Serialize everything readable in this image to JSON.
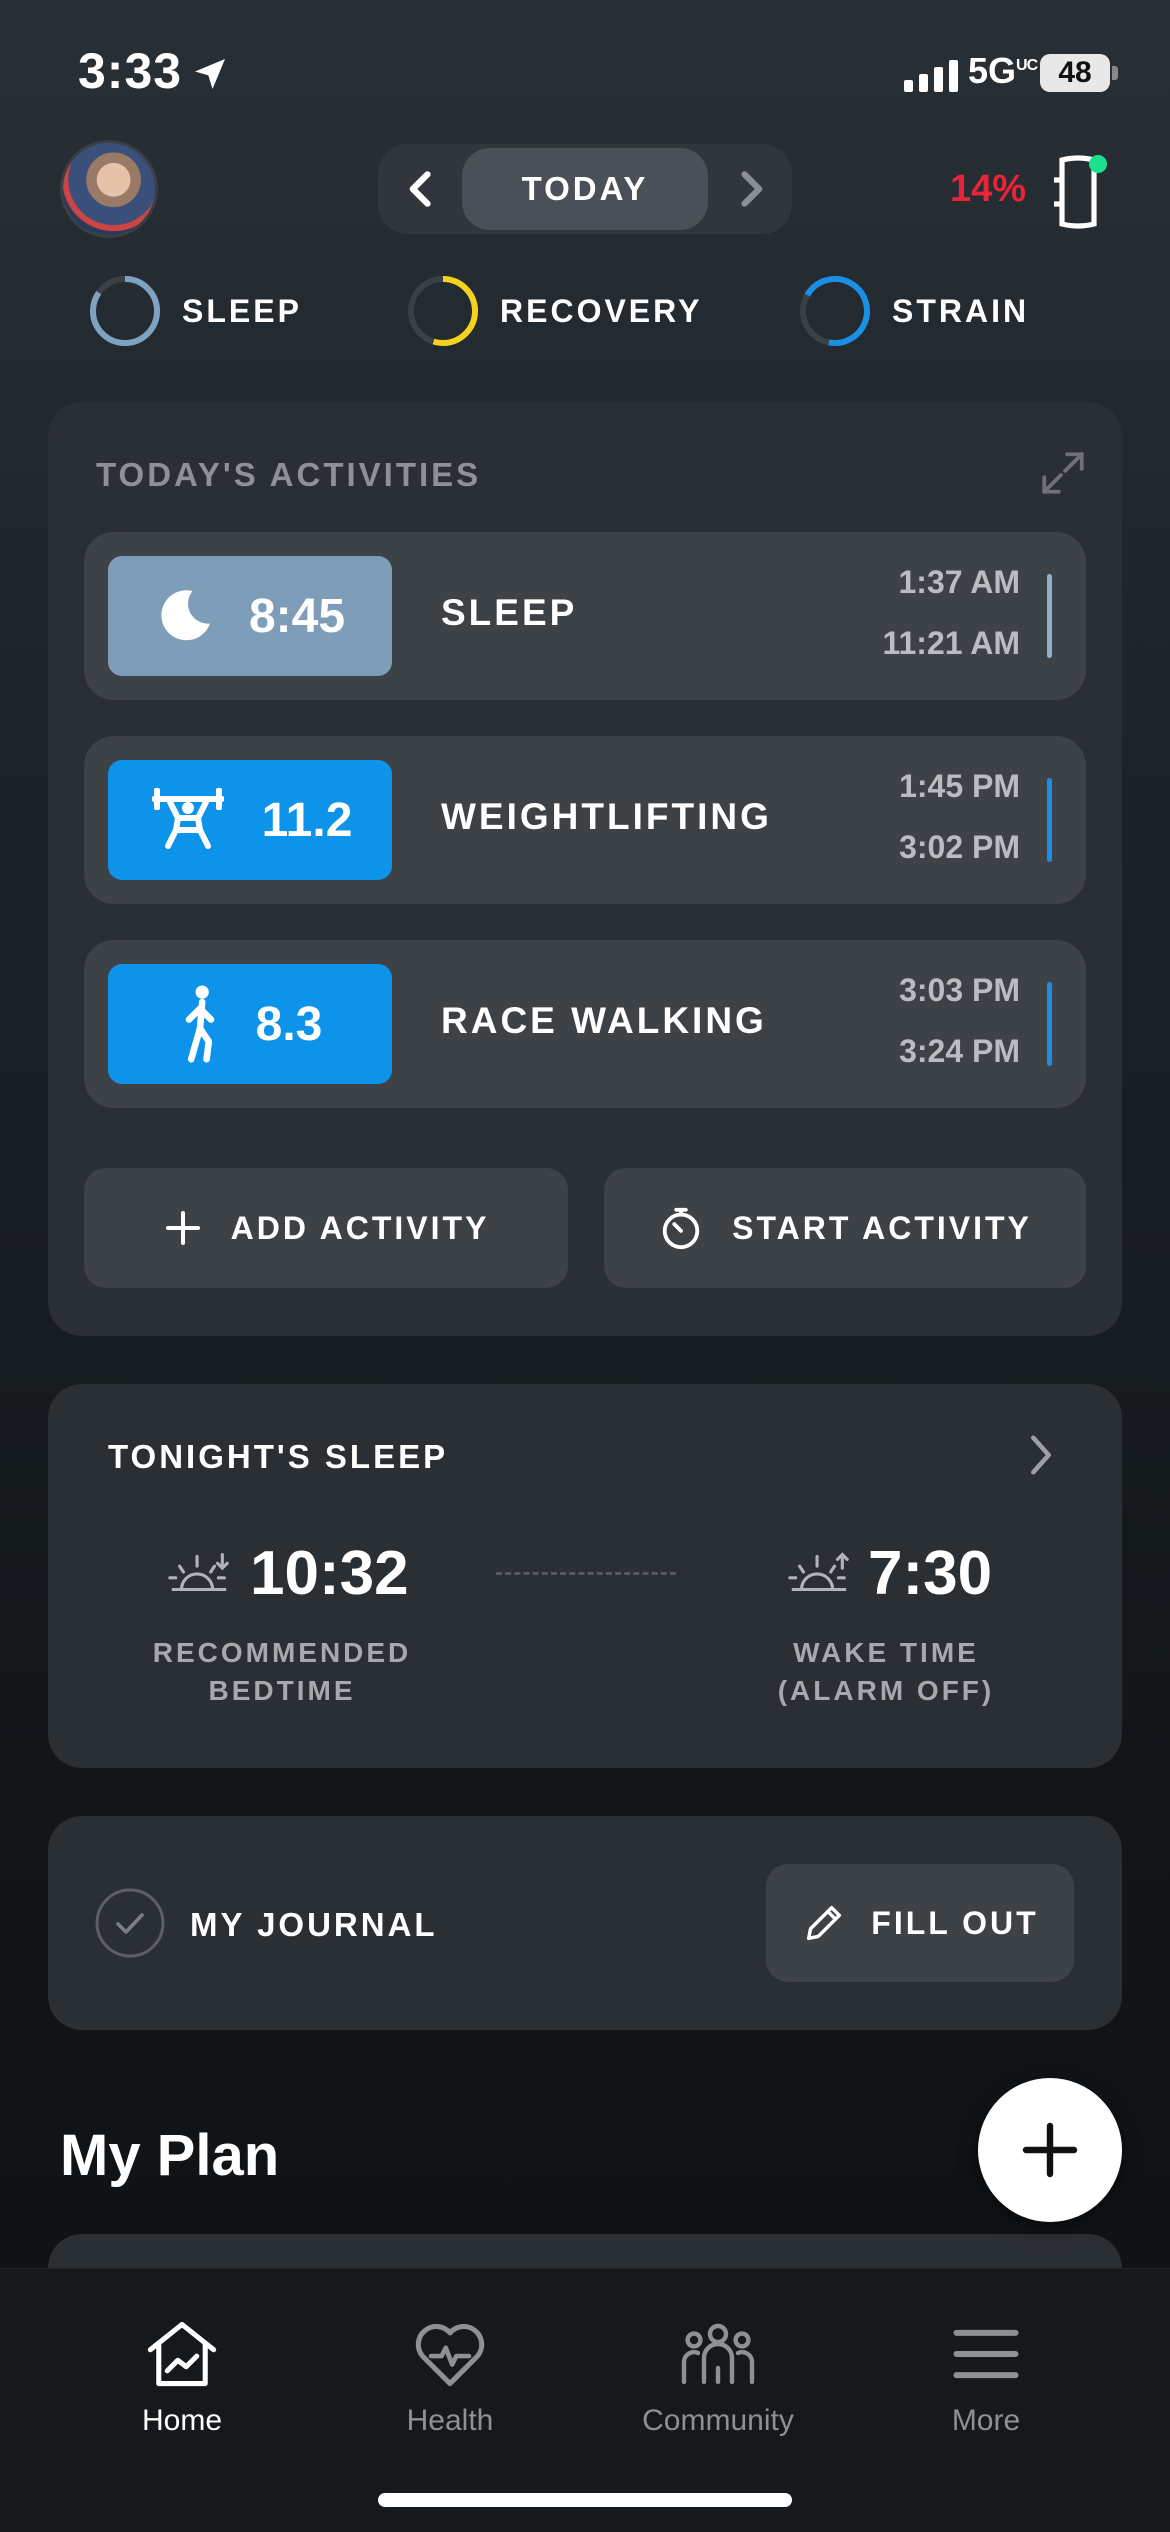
{
  "status_bar": {
    "time": "3:33",
    "network": "5G",
    "network_sup": "UC",
    "battery": "48"
  },
  "header": {
    "date_label": "TODAY",
    "strap_battery": "14%"
  },
  "rings": [
    {
      "label": "SLEEP",
      "color": "#7ea3c2"
    },
    {
      "label": "RECOVERY",
      "color": "#f5d21d"
    },
    {
      "label": "STRAIN",
      "color": "#1a8fe3"
    }
  ],
  "activities": {
    "title": "TODAY'S ACTIVITIES",
    "items": [
      {
        "value": "8:45",
        "name": "SLEEP",
        "start": "1:37 AM",
        "end": "11:21 AM",
        "icon": "moon-icon",
        "color": "#7e9db8"
      },
      {
        "value": "11.2",
        "name": "WEIGHTLIFTING",
        "start": "1:45 PM",
        "end": "3:02 PM",
        "icon": "weightlifting-icon",
        "color": "#0d93ea"
      },
      {
        "value": "8.3",
        "name": "RACE WALKING",
        "start": "3:03 PM",
        "end": "3:24 PM",
        "icon": "walking-icon",
        "color": "#0d93ea"
      }
    ],
    "add_label": "ADD ACTIVITY",
    "start_label": "START ACTIVITY"
  },
  "tonight_sleep": {
    "title": "TONIGHT'S SLEEP",
    "bedtime": "10:32",
    "bedtime_caption_1": "RECOMMENDED",
    "bedtime_caption_2": "BEDTIME",
    "wake": "7:30",
    "wake_caption_1": "WAKE TIME",
    "wake_caption_2": "(ALARM OFF)"
  },
  "journal": {
    "label": "MY JOURNAL",
    "button": "FILL OUT"
  },
  "plan": {
    "title": "My Plan"
  },
  "tabs": [
    {
      "label": "Home",
      "icon": "home-icon",
      "active": true
    },
    {
      "label": "Health",
      "icon": "health-heart-icon",
      "active": false
    },
    {
      "label": "Community",
      "icon": "community-icon",
      "active": false
    },
    {
      "label": "More",
      "icon": "menu-icon",
      "active": false
    }
  ]
}
